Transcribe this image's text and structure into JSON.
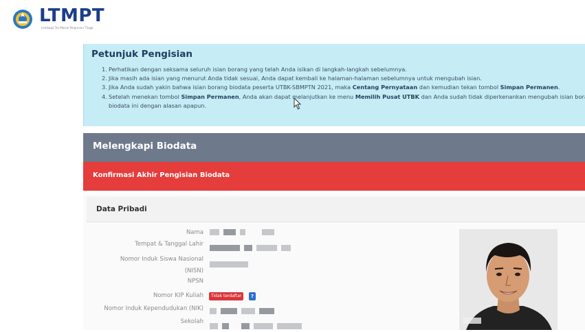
{
  "header": {
    "logo_text": "LTMPT",
    "logo_tagline": "Lembaga Tes Masuk Perguruan Tinggi",
    "logo_icon": "tut-wuri-handayani-emblem"
  },
  "instructions": {
    "title": "Petunjuk Pengisian",
    "items": [
      {
        "num": "1.",
        "text": "Perhatikan dengan seksama seluruh isian borang yang telah Anda isikan di langkah-langkah sebelumnya."
      },
      {
        "num": "2.",
        "text": "Jika masih ada isian yang menurut Anda tidak sesuai, Anda dapat kembali ke halaman-halaman sebelumnya untuk mengubah isian."
      },
      {
        "num": "3.",
        "pre": "Jika Anda sudah yakin bahwa isian borang biodata peserta UTBK-SBMPTN 2021, maka ",
        "b1": "Centang Pernyataan",
        "mid": " dan kemudian tekan tombol ",
        "b2": "Simpan Permanen",
        "post": "."
      },
      {
        "num": "4.",
        "pre": "Setelah menekan tombol ",
        "b1": "Simpan Permanen",
        "mid": ", Anda akan dapat melanjutkan ke menu ",
        "b2": "Memilih Pusat UTBK",
        "post": " dan Anda sudah tidak diperkenankan mengubah isian borang",
        "cont": "biodata ini dengan alasan apapun."
      }
    ]
  },
  "section_title": "Melengkapi Biodata",
  "confirm_title": "Konfirmasi Akhir Pengisian Biodata",
  "data_pribadi": {
    "title": "Data Pribadi",
    "labels": {
      "nama": "Nama",
      "ttl": "Tempat & Tanggal Lahir",
      "nisn_1": "Nomor Induk Siswa Nasional",
      "nisn_2": "(NISN)",
      "npsn": "NPSN",
      "kip": "Nomor KIP Kuliah",
      "nik": "Nomor Induk Kependudukan (NIK)",
      "sekolah": "Sekolah"
    },
    "kip_status": "Tidak terdaftar",
    "help_label": "?"
  },
  "colors": {
    "info_bg": "#c6ecf5",
    "section_bg": "#6e7a8b",
    "alert_bg": "#e53c3c",
    "brand": "#1b3e8a"
  }
}
